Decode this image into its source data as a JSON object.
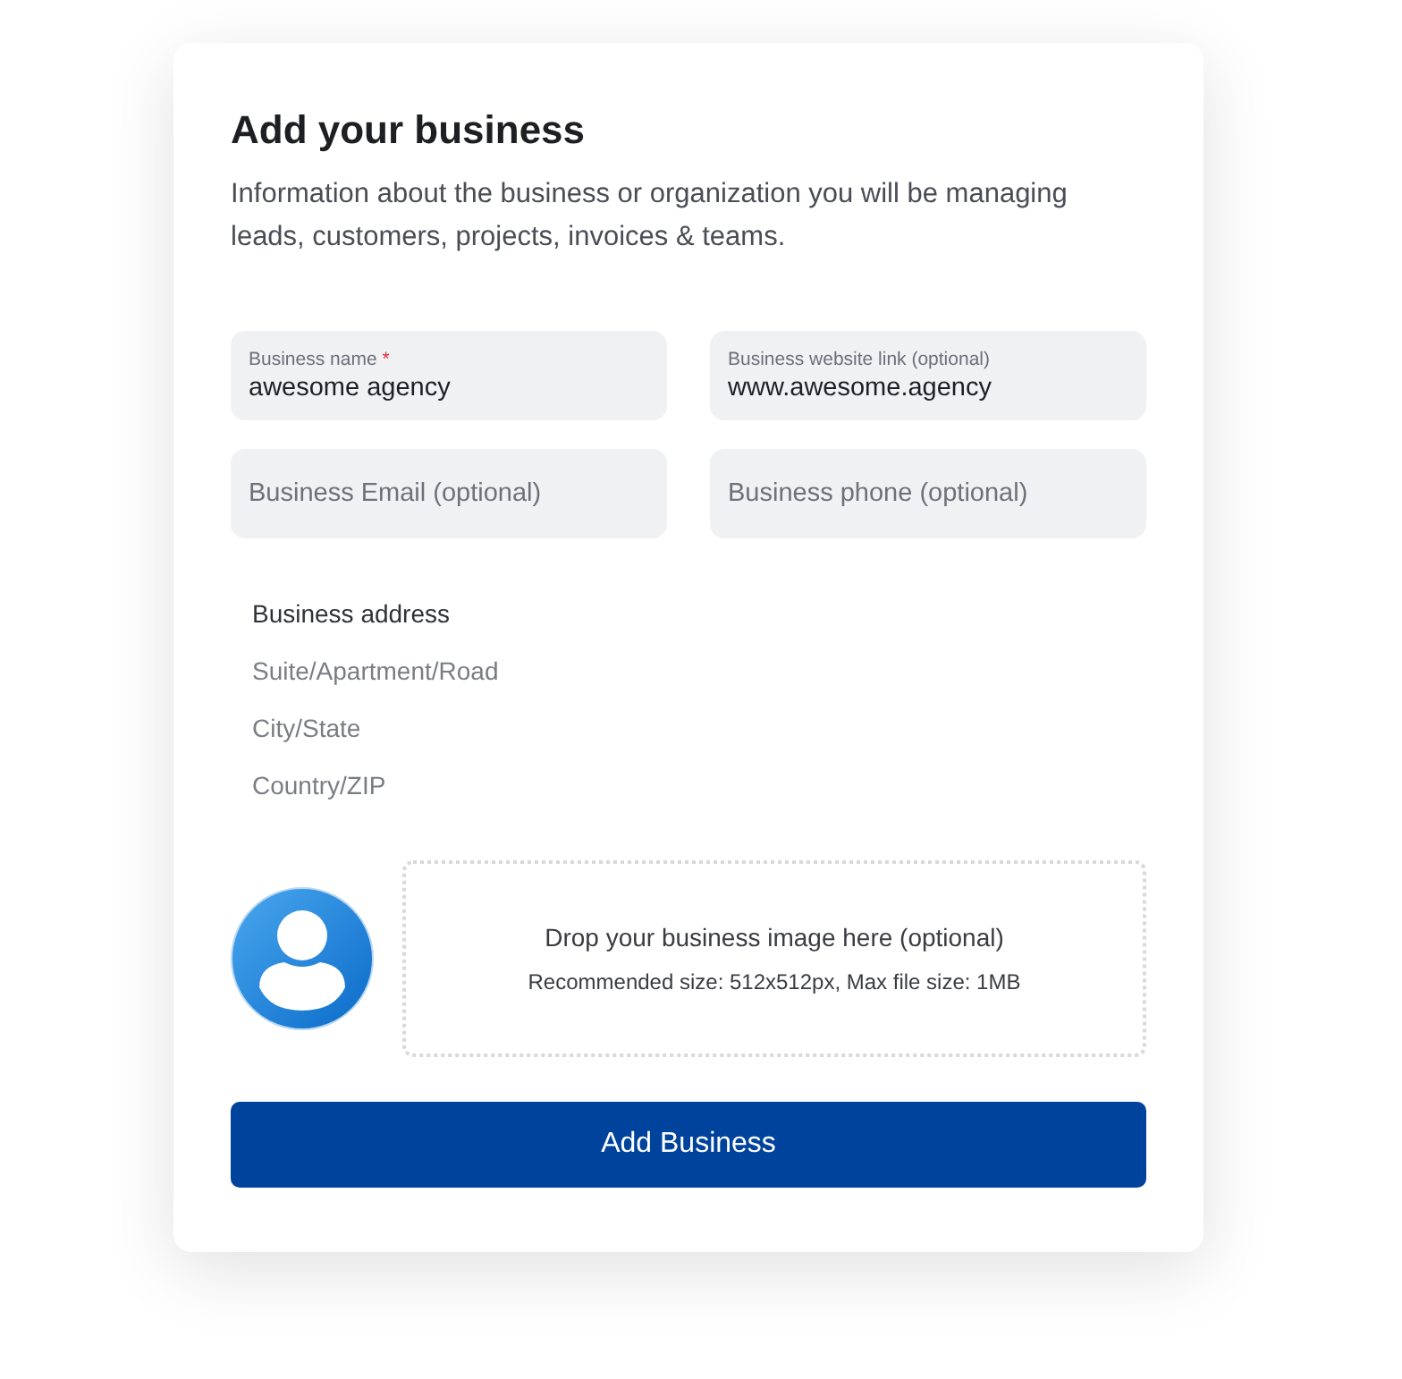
{
  "title": "Add your business",
  "description": "Information about the business or organization you will be managing leads, customers, projects, invoices & teams.",
  "fields": [
    {
      "label": "Business name",
      "required_mark": "*",
      "value": "awesome agency"
    },
    {
      "label": "Business website link (optional)",
      "value": "www.awesome.agency"
    },
    {
      "placeholder": "Business Email (optional)"
    },
    {
      "placeholder": "Business phone (optional)"
    }
  ],
  "address": {
    "label": "Business address",
    "lines": [
      {
        "placeholder": "Suite/Apartment/Road"
      },
      {
        "placeholder": "City/State"
      },
      {
        "placeholder": "Country/ZIP"
      }
    ]
  },
  "upload": {
    "title": "Drop your business image here (optional)",
    "hint": "Recommended size: 512x512px, Max file size: 1MB"
  },
  "submit": "Add Business"
}
